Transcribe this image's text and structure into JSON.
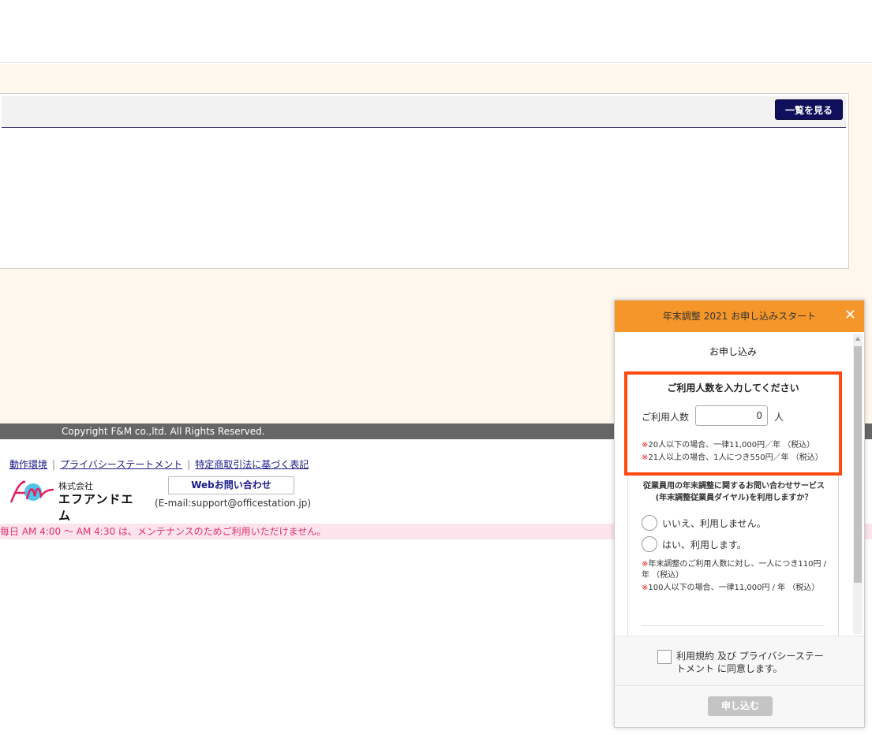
{
  "panel": {
    "list_button_label": "一覧を見る"
  },
  "footer": {
    "copyright": "Copyright F&M co.,ltd. All Rights Reserved.",
    "links": [
      "動作環境",
      "プライバシーステートメント",
      "特定商取引法に基づく表記"
    ],
    "company_small": "株式会社",
    "company_big": "エフアンドエム",
    "web_contact_label": "Webお問い合わせ",
    "email": "(E-mail:support@officestation.jp)",
    "maintenance": "毎日 AM 4:00 ～ AM 4:30 は、メンテナンスのためご利用いただけません。"
  },
  "modal": {
    "title": "年末調整 2021 お申し込みスタート",
    "close_icon": "close-icon",
    "section_title": "お申し込み",
    "users": {
      "title": "ご利用人数を入力してください",
      "label": "ご利用人数",
      "value": "0",
      "unit": "人",
      "note_mark": "※",
      "note1": "20人以下の場合、一律11,000円／年 （税込）",
      "note2": "21人以上の場合、1人につき550円／年 （税込）"
    },
    "question": {
      "line1": "従業員用の年末調整に関するお問い合わせサービス",
      "line2": "(年末調整従業員ダイヤル)を利用しますか？",
      "option_no": "いいえ、利用しません。",
      "option_yes": "はい、利用します。",
      "note1": "年末調整のご利用人数に対し、一人につき110円 / 年 （税込）",
      "note2": "100人以下の場合、一律11,000円 / 年 （税込）"
    },
    "agree_text": "利用規約 及び プライバシーステートメント に同意します。",
    "submit_label": "申し込む"
  },
  "colors": {
    "modal_header": "#f5962a",
    "highlight": "#ff4a10",
    "nav_button": "#0f0f5c",
    "maintenance_text": "#e0306a"
  }
}
